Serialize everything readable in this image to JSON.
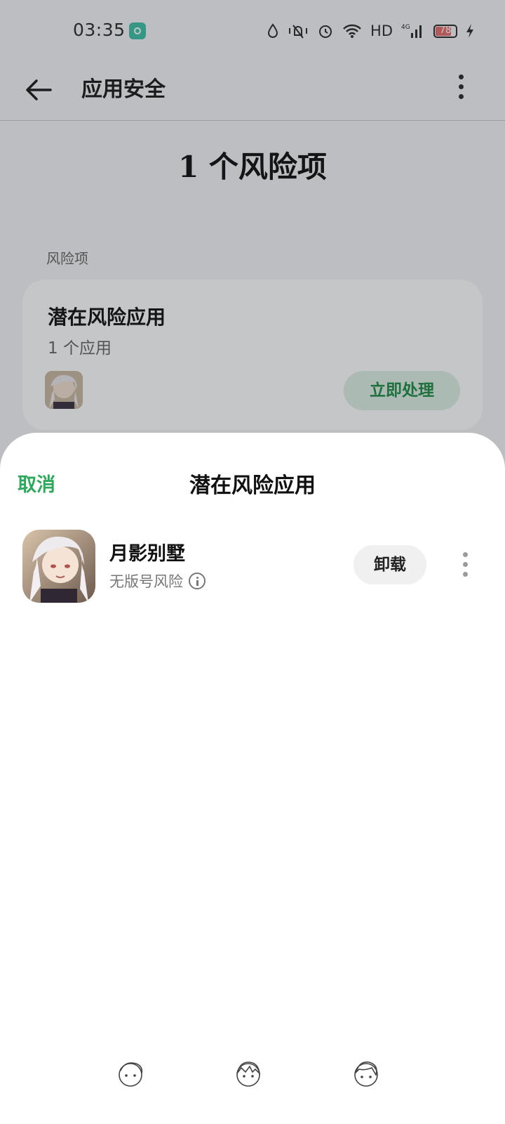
{
  "status_bar": {
    "time": "03:35",
    "network": "HD",
    "network_gen": "4G",
    "battery_level": "78",
    "icons": [
      "app-notification-icon",
      "water-drop-icon",
      "mute-vibrate-icon",
      "alarm-icon",
      "wifi-icon",
      "signal-icon",
      "battery-icon",
      "charging-icon"
    ]
  },
  "header": {
    "title": "应用安全",
    "back_icon": "back-arrow-icon",
    "more_icon": "more-vertical-icon"
  },
  "summary": {
    "risk_count_text": "1 个风险项"
  },
  "risk_section": {
    "label": "风险项",
    "card": {
      "title": "潜在风险应用",
      "subtitle": "1 个应用",
      "action_label": "立即处理"
    }
  },
  "sheet": {
    "cancel_label": "取消",
    "title": "潜在风险应用",
    "apps": [
      {
        "name": "月影别墅",
        "risk": "无版号风险",
        "action_label": "卸载"
      }
    ]
  },
  "colors": {
    "accent_green": "#2ea85a",
    "action_bg": "#dcefe3",
    "page_bg": "#f4f5f7",
    "overlay": "rgba(30,33,40,0.26)"
  },
  "nav_bar": {
    "icons": [
      "nav-back-icon",
      "nav-home-icon",
      "nav-recents-icon"
    ]
  }
}
